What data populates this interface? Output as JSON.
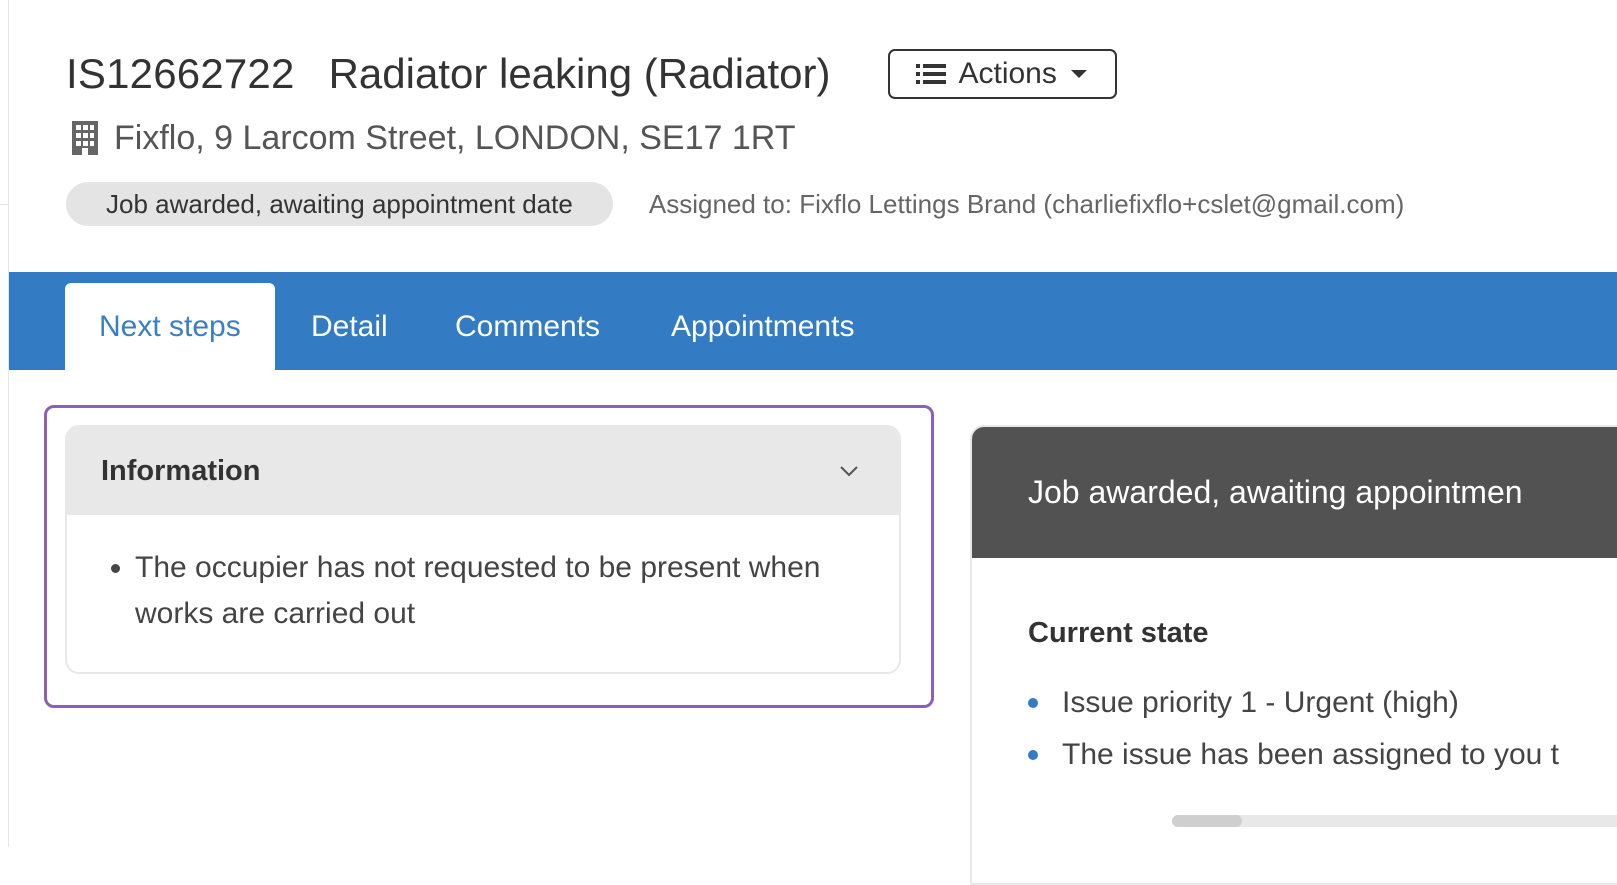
{
  "issue": {
    "reference": "IS12662722",
    "title": "Radiator leaking (Radiator)",
    "address": "Fixflo, 9 Larcom Street, LONDON, SE17 1RT",
    "status_badge": "Job awarded, awaiting appointment date",
    "assigned_to": "Assigned to: Fixflo Lettings Brand (charliefixflo+cslet@gmail.com)"
  },
  "actions": {
    "label": "Actions",
    "icon": "list-icon"
  },
  "tabs": [
    {
      "label": "Next steps",
      "active": true
    },
    {
      "label": "Detail",
      "active": false
    },
    {
      "label": "Comments",
      "active": false
    },
    {
      "label": "Appointments",
      "active": false
    }
  ],
  "information_panel": {
    "title": "Information",
    "items": [
      "The occupier has not requested to be present when works are carried out"
    ]
  },
  "status_panel": {
    "heading": "Job awarded, awaiting appointmen",
    "current_state_title": "Current state",
    "items": [
      "Issue priority 1 - Urgent (high)",
      "The issue has been assigned to you t"
    ]
  },
  "colors": {
    "tab_bar": "#337cc3",
    "status_header": "#525252",
    "highlight_border": "#8c5fb8",
    "badge_background": "#e4e4e4"
  }
}
